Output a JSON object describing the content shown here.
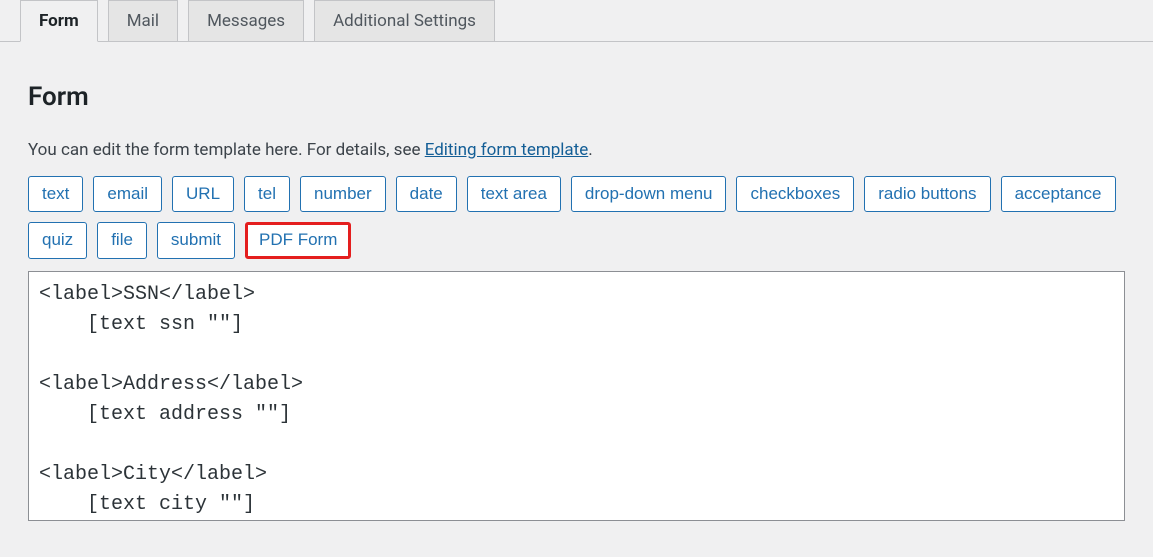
{
  "tabs": [
    {
      "label": "Form",
      "active": true
    },
    {
      "label": "Mail",
      "active": false
    },
    {
      "label": "Messages",
      "active": false
    },
    {
      "label": "Additional Settings",
      "active": false
    }
  ],
  "panel": {
    "heading": "Form",
    "help_text_prefix": "You can edit the form template here. For details, see ",
    "help_link_text": "Editing form template",
    "help_text_suffix": "."
  },
  "tag_buttons": [
    "text",
    "email",
    "URL",
    "tel",
    "number",
    "date",
    "text area",
    "drop-down menu",
    "checkboxes",
    "radio buttons",
    "acceptance",
    "quiz",
    "file",
    "submit",
    "PDF Form"
  ],
  "highlighted_index": 14,
  "textarea_value": "<label>SSN</label>\n    [text ssn \"\"]\n\n<label>Address</label>\n    [text address \"\"]\n\n<label>City</label>\n    [text city \"\"]"
}
